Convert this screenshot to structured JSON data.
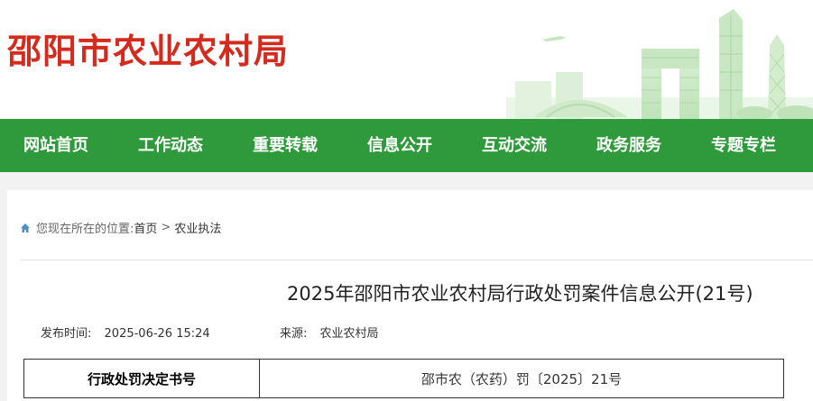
{
  "header": {
    "site_title": "邵阳市农业农村局"
  },
  "nav": {
    "items": [
      {
        "label": "网站首页"
      },
      {
        "label": "工作动态"
      },
      {
        "label": "重要转载"
      },
      {
        "label": "信息公开"
      },
      {
        "label": "互动交流"
      },
      {
        "label": "政务服务"
      },
      {
        "label": "专题专栏"
      }
    ]
  },
  "breadcrumb": {
    "prefix": "您现在所在的位置:",
    "home": "首页",
    "separator": ">",
    "current": "农业执法"
  },
  "article": {
    "title": "2025年邵阳市农业农村局行政处罚案件信息公开(21号)",
    "publish_label": "发布时间:",
    "publish_time": "2025-06-26 15:24",
    "source_label": "来源:",
    "source": "农业农村局"
  },
  "table": {
    "rows": [
      {
        "key": "行政处罚决定书号",
        "value": "邵市农（农药）罚〔2025〕21号"
      }
    ]
  },
  "colors": {
    "brand_red": "#d52b1e",
    "nav_green": "#2f9a3b"
  }
}
